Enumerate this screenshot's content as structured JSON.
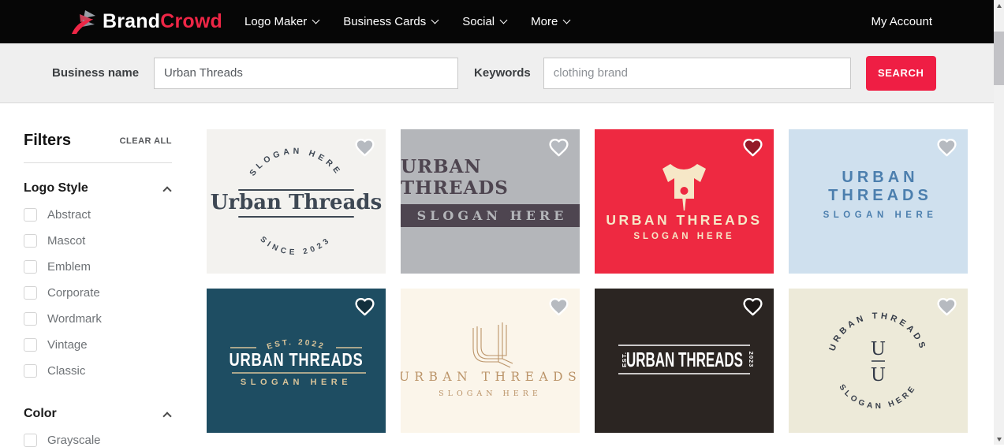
{
  "navbar": {
    "brand_part1": "Brand",
    "brand_part2": "Crowd",
    "items": [
      "Logo Maker",
      "Business Cards",
      "Social",
      "More"
    ],
    "my_account": "My Account"
  },
  "search": {
    "business_label": "Business name",
    "business_value": "Urban Threads",
    "keywords_label": "Keywords",
    "keywords_value": "clothing brand",
    "search_button": "SEARCH",
    "button_color": "#ef1e44"
  },
  "sidebar": {
    "title": "Filters",
    "clear_all": "CLEAR ALL",
    "sections": [
      {
        "title": "Logo Style",
        "items": [
          "Abstract",
          "Mascot",
          "Emblem",
          "Corporate",
          "Wordmark",
          "Vintage",
          "Classic"
        ]
      },
      {
        "title": "Color",
        "items": [
          "Grayscale"
        ]
      }
    ]
  },
  "cards": [
    {
      "style": "stamp-badge",
      "bg": "#f3f2ef",
      "fg": "#3e4854",
      "arc_top": "SLOGAN HERE",
      "brand": "Urban Threads",
      "arc_bottom": "SINCE 2023"
    },
    {
      "style": "western-wordmark",
      "bg": "#b4b6ba",
      "fg": "#4e4550",
      "brand": "URBAN THREADS",
      "slogan": "SLOGAN HERE"
    },
    {
      "style": "tshirt-emblem",
      "bg": "#ee2941",
      "fg": "#f6e7c7",
      "brand": "URBAN THREADS",
      "slogan": "SLOGAN HERE",
      "icon": "t-shirt-needle-icon"
    },
    {
      "style": "modern-wordmark",
      "bg": "#cfe0ee",
      "fg": "#4c7fae",
      "brand": "URBAN THREADS",
      "slogan": "SLOGAN HERE"
    },
    {
      "style": "established-wordmark",
      "bg": "#1e4d62",
      "fg": "#ffffff",
      "accent": "#d9c49a",
      "est": "EST. 2022",
      "brand": "URBAN THREADS",
      "slogan": "SLOGAN HERE"
    },
    {
      "style": "monogram-lines",
      "bg": "#fbf5ea",
      "fg": "#bb9469",
      "brand": "URBAN THREADS",
      "slogan": "SLOGAN HERE",
      "monogram": "U"
    },
    {
      "style": "boxed-wordmark",
      "bg": "#2b2522",
      "fg": "#ffffff",
      "est": "EST.",
      "brand": "URBAN THREADS",
      "year": "2023"
    },
    {
      "style": "circular-monogram",
      "bg": "#edead9",
      "fg": "#333a47",
      "arc_top": "URBAN THREADS",
      "arc_bottom": "SLOGAN HERE",
      "monogram_top": "U",
      "monogram_bottom": "U"
    }
  ]
}
